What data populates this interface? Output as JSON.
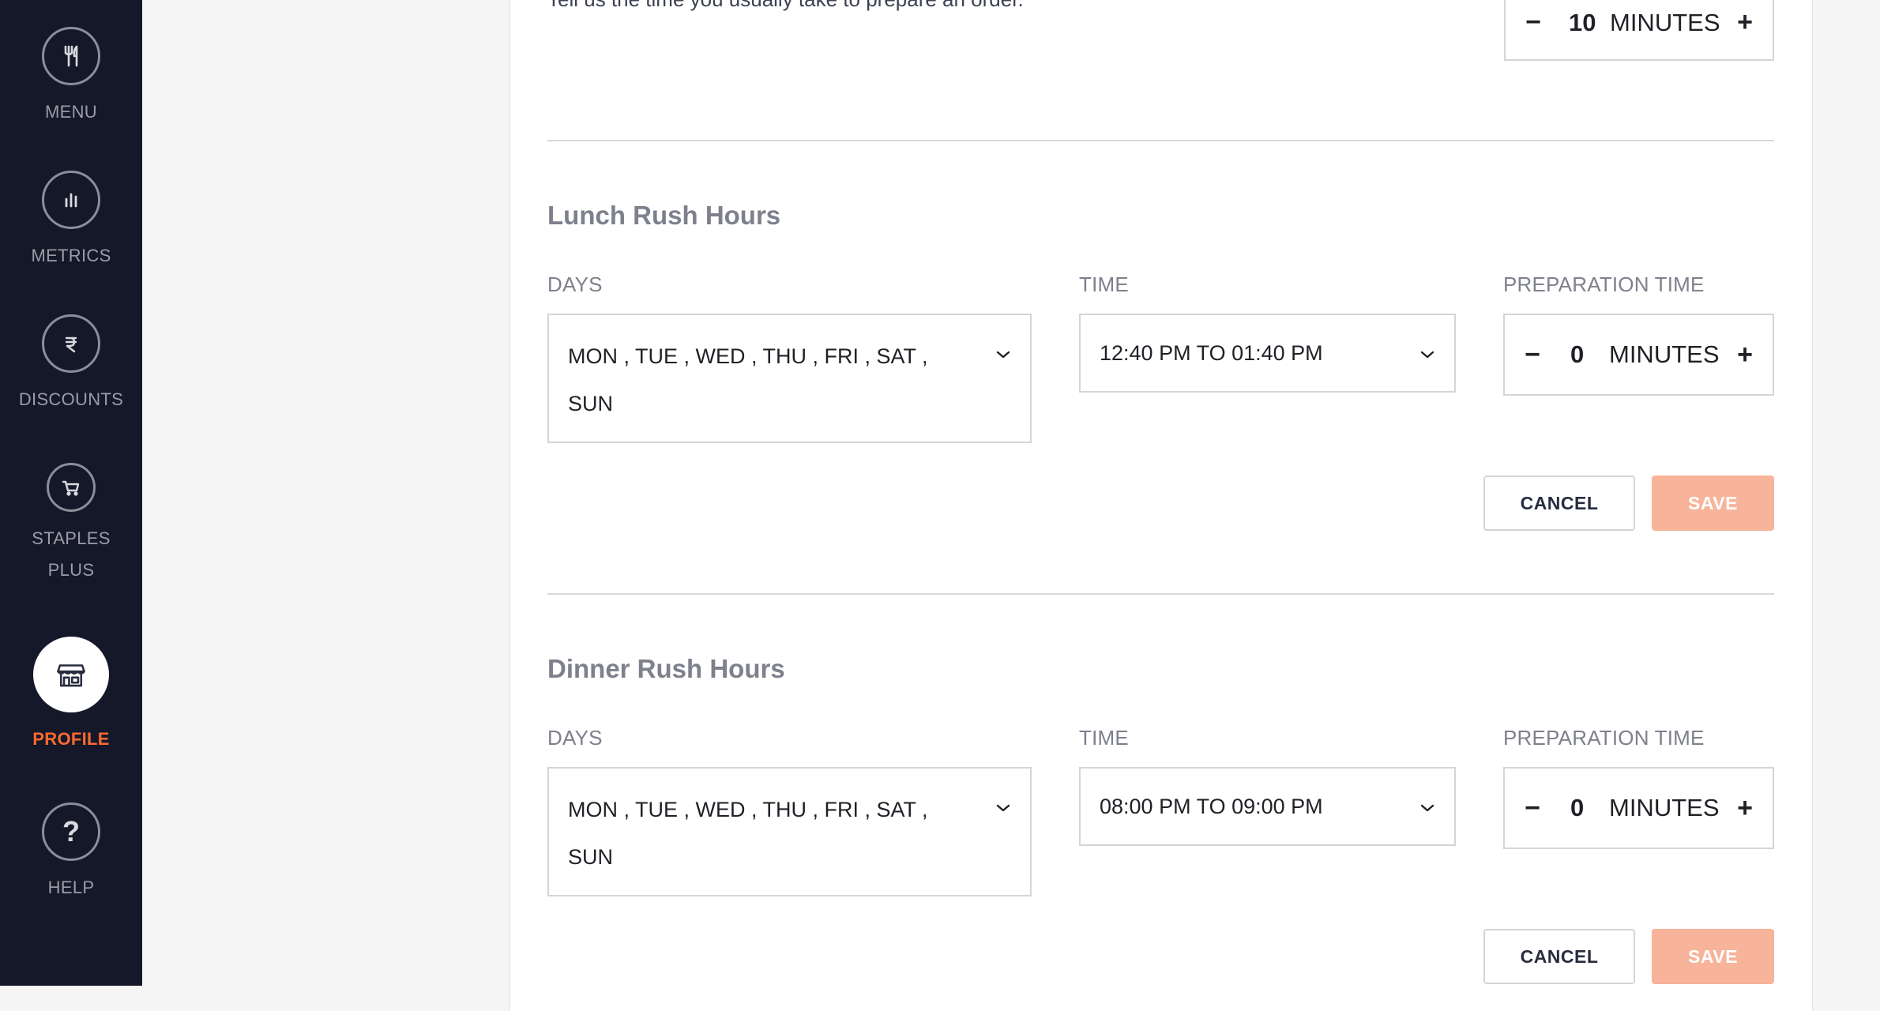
{
  "sidebar": {
    "items": [
      {
        "label": "MENU",
        "icon": "fork-knife-icon"
      },
      {
        "label": "METRICS",
        "icon": "bar-chart-icon"
      },
      {
        "label": "DISCOUNTS",
        "icon": "rupee-icon"
      },
      {
        "label": "STAPLES\nPLUS",
        "label_line1": "STAPLES",
        "label_line2": "PLUS",
        "icon": "cart-icon"
      },
      {
        "label": "PROFILE",
        "icon": "storefront-icon",
        "active": true
      },
      {
        "label": "HELP",
        "icon": "question-icon"
      }
    ],
    "accent_color": "#fc6a2f",
    "background_color": "#151829"
  },
  "top_section": {
    "description": "Tell us the time you usually take to prepare an order.",
    "stepper": {
      "minus": "−",
      "value": "10",
      "unit": "MINUTES",
      "plus": "+"
    }
  },
  "lunch": {
    "title": "Lunch Rush Hours",
    "days_label": "DAYS",
    "days_value_line1": "MON , TUE , WED , THU , FRI , SAT ,",
    "days_value_line2": "SUN",
    "time_label": "TIME",
    "time_value": "12:40 PM TO 01:40 PM",
    "prep_label": "PREPARATION TIME",
    "stepper": {
      "minus": "−",
      "value": "0",
      "unit": "MINUTES",
      "plus": "+"
    },
    "cancel_label": "CANCEL",
    "save_label": "SAVE"
  },
  "dinner": {
    "title": "Dinner Rush Hours",
    "days_label": "DAYS",
    "days_value_line1": "MON , TUE , WED , THU , FRI , SAT ,",
    "days_value_line2": "SUN",
    "time_label": "TIME",
    "time_value": "08:00 PM TO 09:00 PM",
    "prep_label": "PREPARATION TIME",
    "stepper": {
      "minus": "−",
      "value": "0",
      "unit": "MINUTES",
      "plus": "+"
    },
    "cancel_label": "CANCEL",
    "save_label": "SAVE"
  },
  "colors": {
    "save_disabled": "#f7b49a",
    "label_gray": "#7e808c"
  }
}
